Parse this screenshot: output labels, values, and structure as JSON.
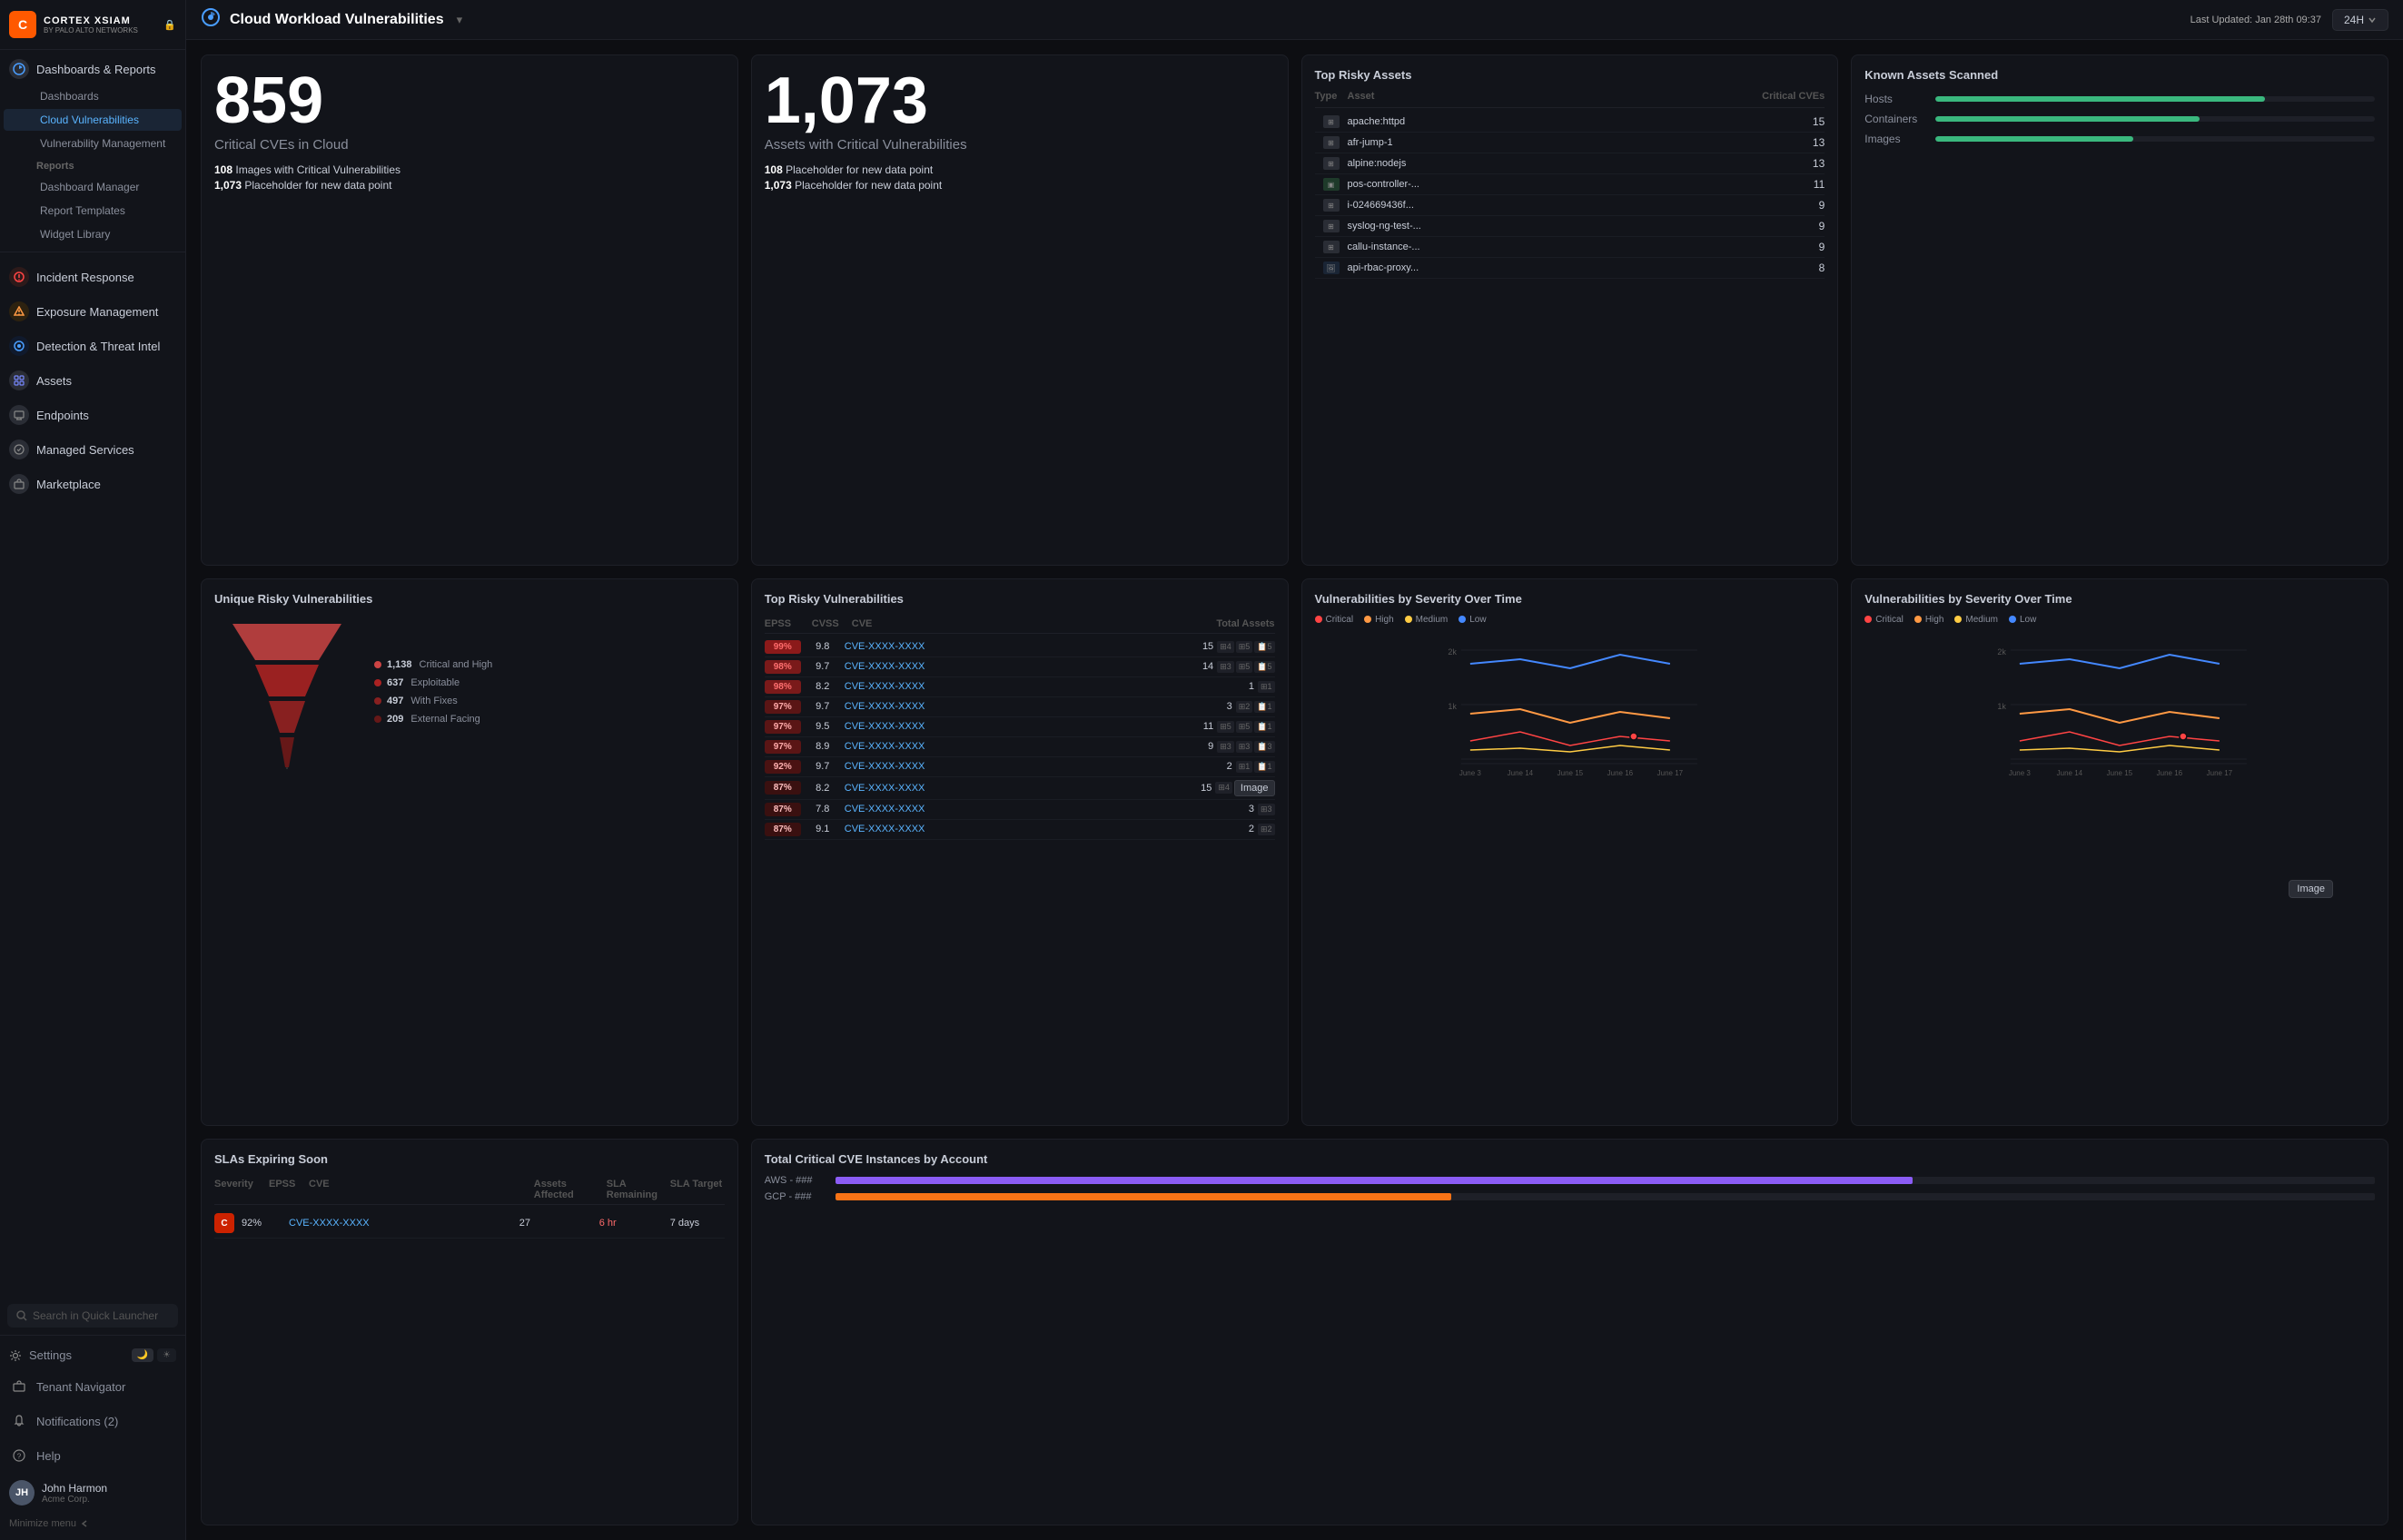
{
  "app": {
    "logo_letter": "C",
    "brand": "CORTEX XSIAM",
    "sub": "BY PALO ALTO NETWORKS"
  },
  "topbar": {
    "page_title": "Cloud Workload Vulnerabilities",
    "last_updated_label": "Last Updated:",
    "last_updated_value": "Jan 28th 09:37",
    "time_range": "24H"
  },
  "sidebar": {
    "minimize_label": "Minimize menu",
    "sections": [
      {
        "id": "dashboards",
        "label": "Dashboards & Reports",
        "icon": "📊",
        "active": true,
        "subitems": [
          {
            "label": "Dashboards",
            "active": false
          },
          {
            "label": "Cloud Vulnerabilities",
            "active": true,
            "selected": true
          },
          {
            "label": "Vulnerability Management",
            "active": false
          },
          {
            "label": "Reports",
            "active": false
          },
          {
            "label": "Dashboard Manager",
            "active": false
          },
          {
            "label": "Report Templates",
            "active": false
          },
          {
            "label": "Widget Library",
            "active": false
          }
        ]
      },
      {
        "id": "incident",
        "label": "Incident Response",
        "icon": "🔴",
        "active": false
      },
      {
        "id": "exposure",
        "label": "Exposure Management",
        "icon": "🔶",
        "active": false
      },
      {
        "id": "detection",
        "label": "Detection & Threat Intel",
        "icon": "🔵",
        "active": false
      },
      {
        "id": "assets",
        "label": "Assets",
        "icon": "💠",
        "active": false
      },
      {
        "id": "endpoints",
        "label": "Endpoints",
        "icon": "💻",
        "active": false
      },
      {
        "id": "managed",
        "label": "Managed Services",
        "icon": "🔧",
        "active": false
      },
      {
        "id": "marketplace",
        "label": "Marketplace",
        "icon": "🛒",
        "active": false
      }
    ],
    "search_placeholder": "Search in Quick Launcher",
    "bottom": {
      "settings": "Settings",
      "tenant": "Tenant Navigator",
      "notifications": "Notifications (2)",
      "help": "Help"
    },
    "user": {
      "initials": "JH",
      "name": "John Harmon",
      "org": "Acme Corp."
    }
  },
  "stats": {
    "critical_cves": {
      "number": "859",
      "label": "Critical CVEs in Cloud",
      "sub1_count": "108",
      "sub1_text": "Images with Critical Vulnerabilities",
      "sub2_count": "1,073",
      "sub2_text": "Placeholder for new data point"
    },
    "assets_critical": {
      "number": "1,073",
      "label": "Assets with Critical Vulnerabilities",
      "sub1_count": "108",
      "sub1_text": "Placeholder for new data point",
      "sub2_count": "1,073",
      "sub2_text": "Placeholder for new data point"
    }
  },
  "risky_assets": {
    "title": "Top Risky Assets",
    "columns": [
      "Type",
      "Asset",
      "Critical CVEs"
    ],
    "rows": [
      {
        "type": "server",
        "name": "apache:httpd",
        "cves": 15
      },
      {
        "type": "server",
        "name": "afr-jump-1",
        "cves": 13
      },
      {
        "type": "server",
        "name": "alpine:nodejs",
        "cves": 13
      },
      {
        "type": "container",
        "name": "pos-controller-...",
        "cves": 11
      },
      {
        "type": "server",
        "name": "i-024669436f...",
        "cves": 9
      },
      {
        "type": "server",
        "name": "syslog-ng-test-...",
        "cves": 9
      },
      {
        "type": "server",
        "name": "callu-instance-...",
        "cves": 9
      },
      {
        "type": "image",
        "name": "api-rbac-proxy...",
        "cves": 8
      }
    ]
  },
  "known_assets": {
    "title": "Known Assets Scanned",
    "items": [
      {
        "label": "Hosts",
        "fill_pct": 75
      },
      {
        "label": "Containers",
        "fill_pct": 60
      },
      {
        "label": "Images",
        "fill_pct": 45
      }
    ]
  },
  "unique_risky": {
    "title": "Unique Risky Vulnerabilities",
    "funnel_items": [
      {
        "label": "Critical and High",
        "count": "1,138",
        "color": "#cc4444"
      },
      {
        "label": "Exploitable",
        "count": "637",
        "color": "#aa2222"
      },
      {
        "label": "With Fixes",
        "count": "497",
        "color": "#882020"
      },
      {
        "label": "External Facing",
        "count": "209",
        "color": "#661818"
      }
    ]
  },
  "top_risky_vulns": {
    "title": "Top Risky Vulnerabilities",
    "columns": [
      "EPSS",
      "CVSS",
      "CVE",
      "Total Assets"
    ],
    "rows": [
      {
        "epss": "99%",
        "cvss": "9.8",
        "cve": "CVE-XXXX-XXXX",
        "assets": 15,
        "icons": "[⊞4 ⊞5 📋5]"
      },
      {
        "epss": "98%",
        "cvss": "9.7",
        "cve": "CVE-XXXX-XXXX",
        "assets": 14,
        "icons": "[⊞3 ⊞5 📋5]"
      },
      {
        "epss": "98%",
        "cvss": "8.2",
        "cve": "CVE-XXXX-XXXX",
        "assets": 1,
        "icons": "[⊞1]"
      },
      {
        "epss": "97%",
        "cvss": "9.7",
        "cve": "CVE-XXXX-XXXX",
        "assets": 3,
        "icons": "[⊞2 📋1]"
      },
      {
        "epss": "97%",
        "cvss": "9.5",
        "cve": "CVE-XXXX-XXXX",
        "assets": 11,
        "icons": "[⊞5 ⊞5 📋1]"
      },
      {
        "epss": "97%",
        "cvss": "8.9",
        "cve": "CVE-XXXX-XXXX",
        "assets": 9,
        "icons": "[⊞3 ⊞3 📋3]"
      },
      {
        "epss": "92%",
        "cvss": "9.7",
        "cve": "CVE-XXXX-XXXX",
        "assets": 2,
        "icons": "[⊞1 📋1]"
      },
      {
        "epss": "87%",
        "cvss": "8.2",
        "cve": "CVE-XXXX-XXXX",
        "assets": 15,
        "icons": "[⊞4 Image]"
      },
      {
        "epss": "87%",
        "cvss": "7.8",
        "cve": "CVE-XXXX-XXXX",
        "assets": 3,
        "icons": "[⊞3]"
      },
      {
        "epss": "87%",
        "cvss": "9.1",
        "cve": "CVE-XXXX-XXXX",
        "assets": 2,
        "icons": "[⊞2]"
      }
    ],
    "tooltip": "Image"
  },
  "severity_chart": {
    "title": "Vulnerabilities by Severity Over Time",
    "legend": [
      {
        "label": "Critical",
        "color": "#ff4444"
      },
      {
        "label": "High",
        "color": "#ff9944"
      },
      {
        "label": "Medium",
        "color": "#ffcc44"
      },
      {
        "label": "Low",
        "color": "#4488ff"
      }
    ],
    "x_labels": [
      "June 3",
      "June 14",
      "June 15",
      "June 16",
      "June 17"
    ],
    "y_labels": [
      "2k",
      "1k"
    ]
  },
  "sla_expiring": {
    "title": "SLAs Expiring Soon",
    "columns": [
      "Severity",
      "EPSS",
      "CVE",
      "Assets Affected",
      "SLA Remaining",
      "SLA Target"
    ],
    "rows": [
      {
        "severity": "C",
        "epss": "92%",
        "cve": "CVE-XXXX-XXXX",
        "assets": 27,
        "sla_remaining": "6 hr",
        "sla_target": "7 days"
      }
    ]
  },
  "total_critical_cve": {
    "title": "Total Critical CVE Instances by Account",
    "rows": [
      {
        "account": "AWS - ###",
        "fill_pct": 70,
        "color": "#8b5cf6"
      },
      {
        "account": "GCP - ###",
        "fill_pct": 40,
        "color": "#f97316"
      }
    ]
  }
}
